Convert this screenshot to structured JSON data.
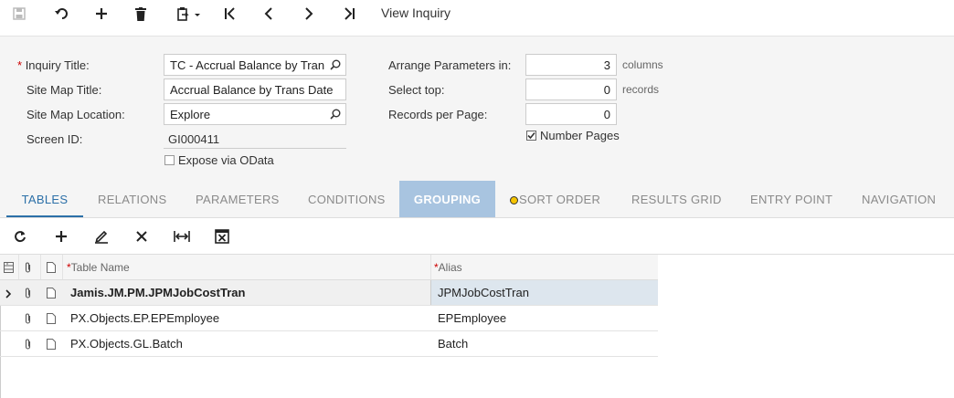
{
  "toolbar": {
    "title": "View Inquiry",
    "buttons": [
      "save-icon",
      "undo-icon",
      "add-icon",
      "delete-icon",
      "copy-paste-icon",
      "first-record-icon",
      "previous-record-icon",
      "next-record-icon",
      "last-record-icon"
    ]
  },
  "form": {
    "inquiry_title_label": "Inquiry Title:",
    "inquiry_title_value": "TC - Accrual Balance by Tran",
    "site_map_title_label": "Site Map Title:",
    "site_map_title_value": "Accrual Balance by Trans Date",
    "site_map_location_label": "Site Map Location:",
    "site_map_location_value": "Explore",
    "screen_id_label": "Screen ID:",
    "screen_id_value": "GI000411",
    "expose_odata_label": "Expose via OData",
    "expose_odata_checked": false,
    "arrange_label": "Arrange Parameters in:",
    "arrange_value": "3",
    "arrange_unit": "columns",
    "select_top_label": "Select top:",
    "select_top_value": "0",
    "select_top_unit": "records",
    "records_per_page_label": "Records per Page:",
    "records_per_page_value": "0",
    "number_pages_label": "Number Pages",
    "number_pages_checked": true
  },
  "tabs": [
    {
      "label": "TABLES",
      "state": "active"
    },
    {
      "label": "RELATIONS",
      "state": "normal"
    },
    {
      "label": "PARAMETERS",
      "state": "normal"
    },
    {
      "label": "CONDITIONS",
      "state": "normal"
    },
    {
      "label": "GROUPING",
      "state": "selected"
    },
    {
      "label": "SORT ORDER",
      "state": "warning"
    },
    {
      "label": "RESULTS GRID",
      "state": "normal"
    },
    {
      "label": "ENTRY POINT",
      "state": "normal"
    },
    {
      "label": "NAVIGATION",
      "state": "normal"
    }
  ],
  "grid": {
    "columns": {
      "table_name": "Table Name",
      "alias": "Alias"
    },
    "rows": [
      {
        "table_name": "Jamis.JM.PM.JPMJobCostTran",
        "alias": "JPMJobCostTran",
        "current": true
      },
      {
        "table_name": "PX.Objects.EP.EPEmployee",
        "alias": "EPEmployee",
        "current": false
      },
      {
        "table_name": "PX.Objects.GL.Batch",
        "alias": "Batch",
        "current": false
      }
    ]
  },
  "colors": {
    "accent": "#2c70a8",
    "selected_tab": "#a8c4e0",
    "required": "#c00000"
  }
}
